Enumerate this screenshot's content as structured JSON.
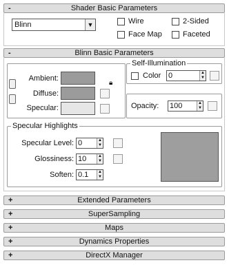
{
  "shader_basic": {
    "toggle": "-",
    "title": "Shader Basic Parameters",
    "shader_select": "Blinn",
    "options": {
      "wire": "Wire",
      "two_sided": "2-Sided",
      "face_map": "Face Map",
      "faceted": "Faceted"
    }
  },
  "blinn_basic": {
    "toggle": "-",
    "title": "Blinn Basic Parameters",
    "ambient_label": "Ambient:",
    "diffuse_label": "Diffuse:",
    "specular_label": "Specular:",
    "self_illum": {
      "group_title": "Self-Illumination",
      "color_label": "Color",
      "value": "0"
    },
    "opacity_label": "Opacity:",
    "opacity_value": "100",
    "specular_highlights": {
      "group_title": "Specular Highlights",
      "level_label": "Specular Level:",
      "level_value": "0",
      "gloss_label": "Glossiness:",
      "gloss_value": "10",
      "soften_label": "Soften:",
      "soften_value": "0.1"
    }
  },
  "colors": {
    "ambient": "#9b9b9b",
    "diffuse": "#9b9b9b",
    "specular": "#e6e6e6",
    "highlight_curve_bg": "#9e9e9e"
  },
  "collapsed_rollouts": [
    {
      "toggle": "+",
      "title": "Extended Parameters"
    },
    {
      "toggle": "+",
      "title": "SuperSampling"
    },
    {
      "toggle": "+",
      "title": "Maps"
    },
    {
      "toggle": "+",
      "title": "Dynamics Properties"
    },
    {
      "toggle": "+",
      "title": "DirectX Manager"
    }
  ]
}
